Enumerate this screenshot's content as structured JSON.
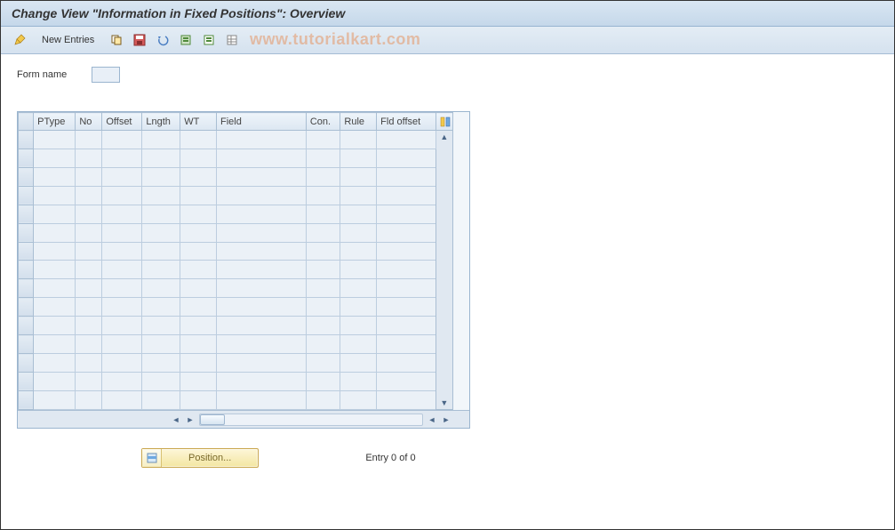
{
  "title": "Change View \"Information in Fixed Positions\": Overview",
  "toolbar": {
    "new_entries": "New Entries"
  },
  "watermark": "www.tutorialkart.com",
  "form": {
    "label": "Form name",
    "value": ""
  },
  "table": {
    "columns": [
      "PType",
      "No",
      "Offset",
      "Lngth",
      "WT",
      "Field",
      "Con.",
      "Rule",
      "Fld offset"
    ],
    "rows": 15
  },
  "footer": {
    "position_label": "Position...",
    "entry_text": "Entry 0 of 0"
  }
}
